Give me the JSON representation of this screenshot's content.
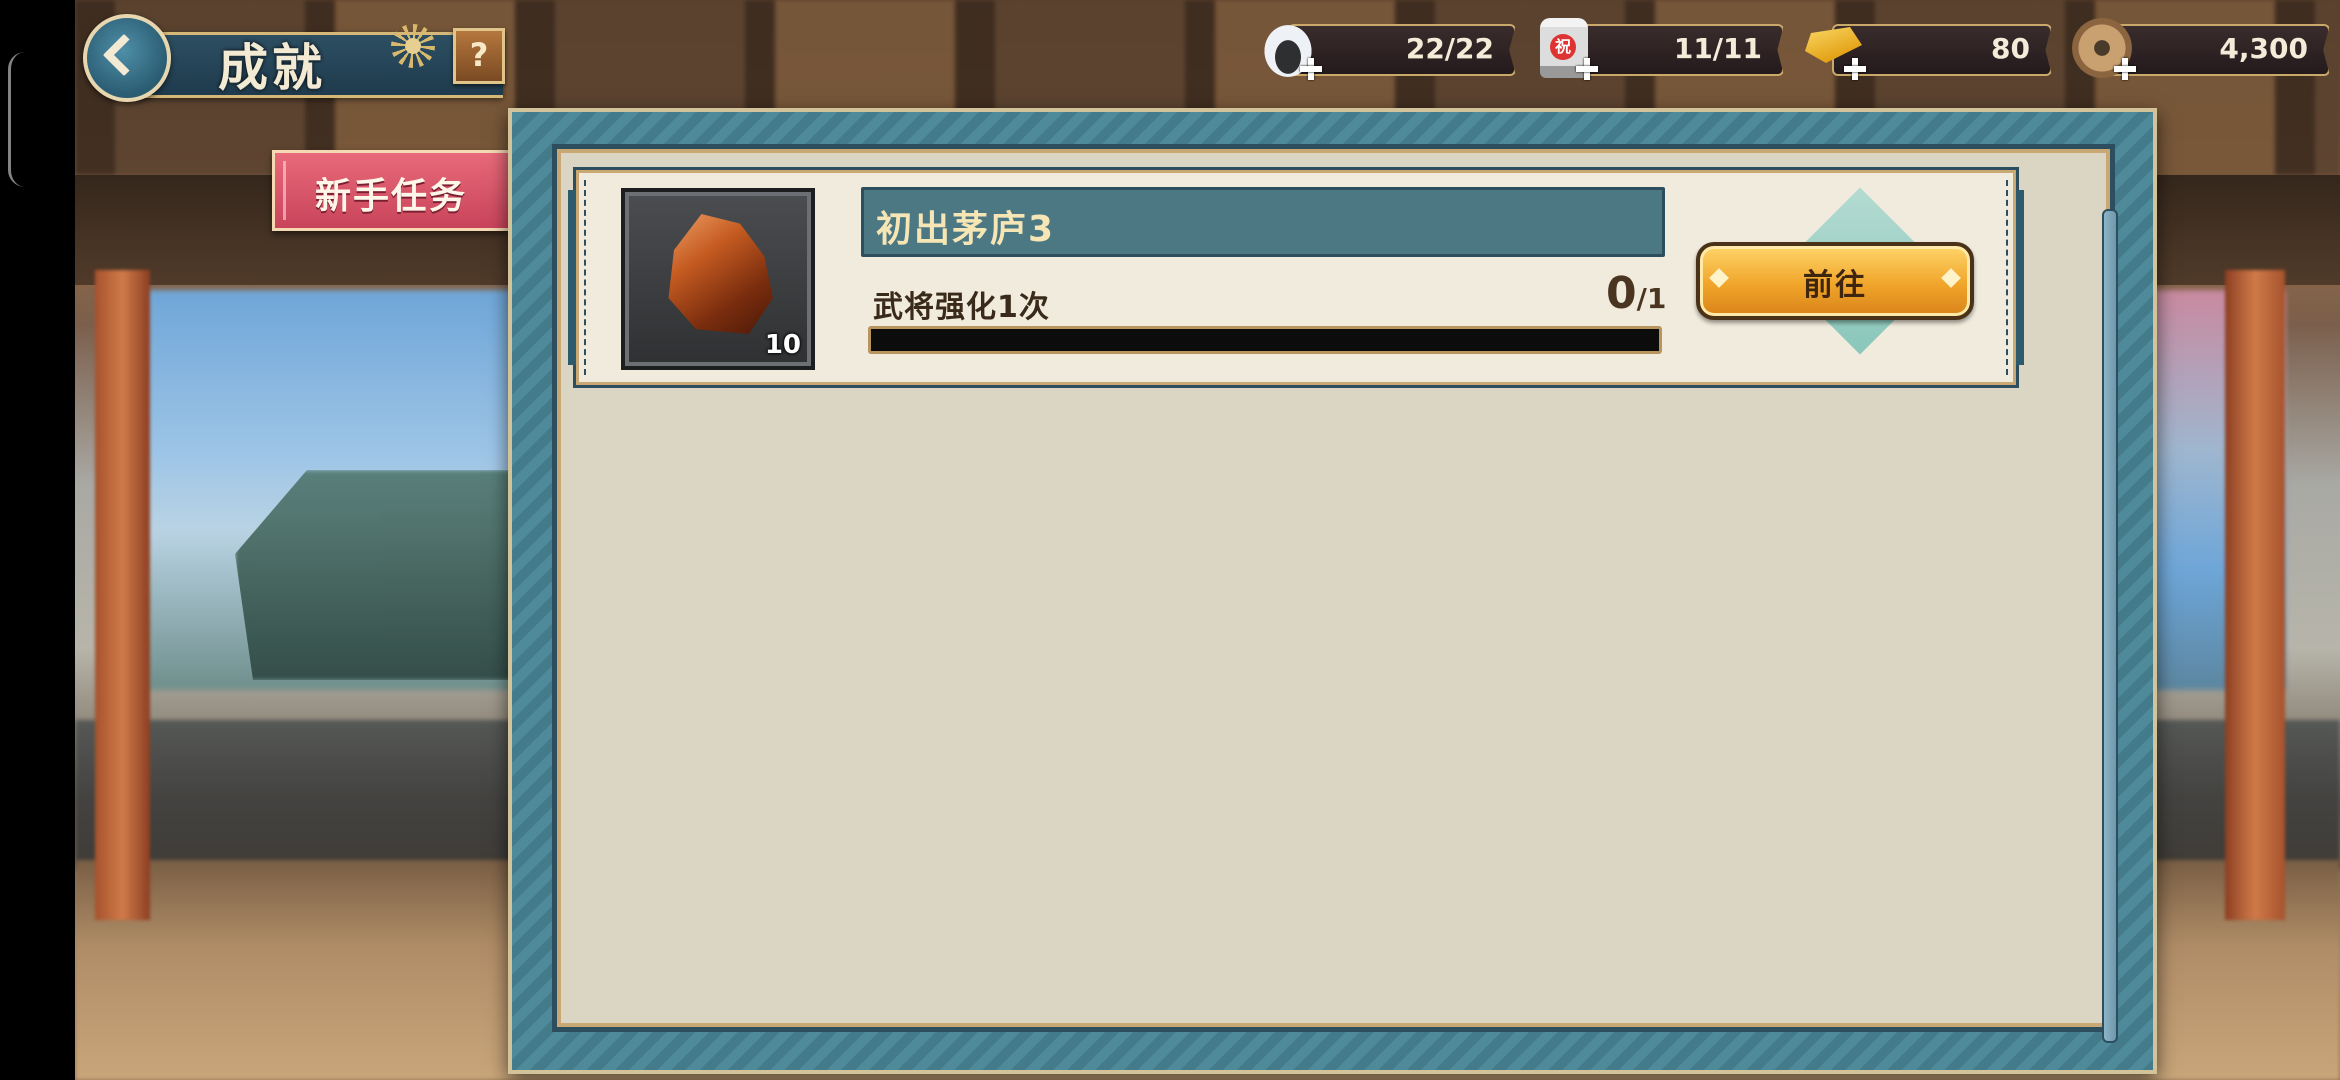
{
  "header": {
    "title": "成就",
    "help_label": "?"
  },
  "tabs": [
    {
      "label": "新手任务",
      "active": true
    }
  ],
  "resources": [
    {
      "name": "rice-ball",
      "icon": "onigiri-icon",
      "value": "22/22"
    },
    {
      "name": "sake-barrel",
      "icon": "sake-barrel-icon",
      "value": "11/11",
      "icon_text": "祝"
    },
    {
      "name": "gold-bar",
      "icon": "gold-bar-icon",
      "value": "80"
    },
    {
      "name": "copper-coin",
      "icon": "coin-icon",
      "value": "4,300"
    }
  ],
  "quests": [
    {
      "title": "初出茅庐3",
      "description": "武将强化1次",
      "progress_current": "0",
      "progress_total": "/1",
      "progress_fraction": 0,
      "reward": {
        "icon": "ore-icon",
        "count": "10"
      },
      "action_label": "前往"
    }
  ],
  "colors": {
    "panel_teal": "#4f8a9a",
    "title_band": "#4b7882",
    "tab_red": "#d9566a",
    "button_gold": "#f0a52a"
  }
}
